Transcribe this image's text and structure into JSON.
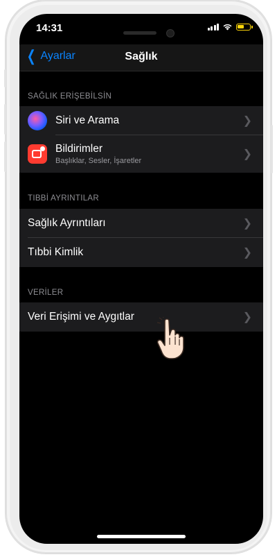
{
  "status": {
    "time": "14:31"
  },
  "nav": {
    "back_label": "Ayarlar",
    "title": "Sağlık"
  },
  "sections": [
    {
      "header": "SAĞLIK ERİŞEBİLSİN",
      "rows": [
        {
          "label": "Siri ve Arama",
          "icon": "siri-icon"
        },
        {
          "label": "Bildirimler",
          "sublabel": "Başlıklar, Sesler, İşaretler",
          "icon": "notifications-icon"
        }
      ]
    },
    {
      "header": "TIBBİ AYRINTILAR",
      "rows": [
        {
          "label": "Sağlık Ayrıntıları"
        },
        {
          "label": "Tıbbi Kimlik"
        }
      ]
    },
    {
      "header": "VERİLER",
      "rows": [
        {
          "label": "Veri Erişimi ve Aygıtlar"
        }
      ]
    }
  ],
  "colors": {
    "accent": "#0a84ff",
    "battery": "#ffd60a",
    "notif_icon": "#ff3b30"
  }
}
